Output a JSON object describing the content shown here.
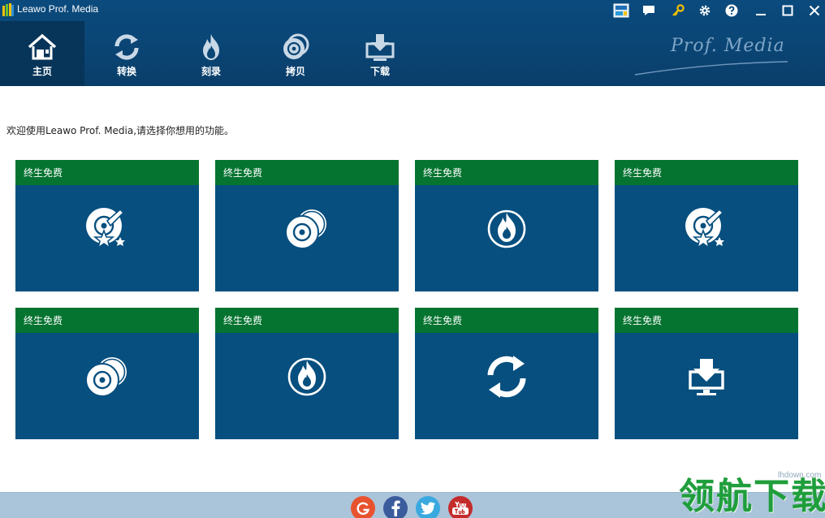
{
  "window": {
    "title": "Leawo Prof. Media"
  },
  "nav": {
    "items": [
      {
        "label": "主页",
        "icon": "home-icon",
        "active": true
      },
      {
        "label": "转换",
        "icon": "convert-icon",
        "active": false
      },
      {
        "label": "刻录",
        "icon": "burn-icon",
        "active": false
      },
      {
        "label": "拷贝",
        "icon": "copy-disc-icon",
        "active": false
      },
      {
        "label": "下载",
        "icon": "download-icon",
        "active": false
      }
    ]
  },
  "brand": {
    "text": "Prof. Media"
  },
  "main": {
    "welcome": "欢迎使用Leawo Prof. Media,请选择你想用的功能。",
    "cards": [
      {
        "badge": "终生免费",
        "icon": "disc-star-icon"
      },
      {
        "badge": "终生免费",
        "icon": "disc-pair-icon"
      },
      {
        "badge": "终生免费",
        "icon": "disc-flame-icon"
      },
      {
        "badge": "终生免费",
        "icon": "disc-star-icon"
      },
      {
        "badge": "终生免费",
        "icon": "disc-pair-icon"
      },
      {
        "badge": "终生免费",
        "icon": "disc-flame-icon"
      },
      {
        "badge": "终生免费",
        "icon": "refresh-icon"
      },
      {
        "badge": "终生免费",
        "icon": "download-monitor-icon"
      }
    ]
  },
  "watermark": {
    "url": "lhdown.com",
    "text": "领航下载"
  },
  "colors": {
    "header": "#0a4676",
    "nav_active": "#073459",
    "card_head": "#067431",
    "card_body": "#074f7f",
    "footer": "#aac4da",
    "google": "#e8532f",
    "facebook": "#3b5c9c",
    "twitter": "#3aa9e0",
    "youtube": "#c42b2b"
  }
}
